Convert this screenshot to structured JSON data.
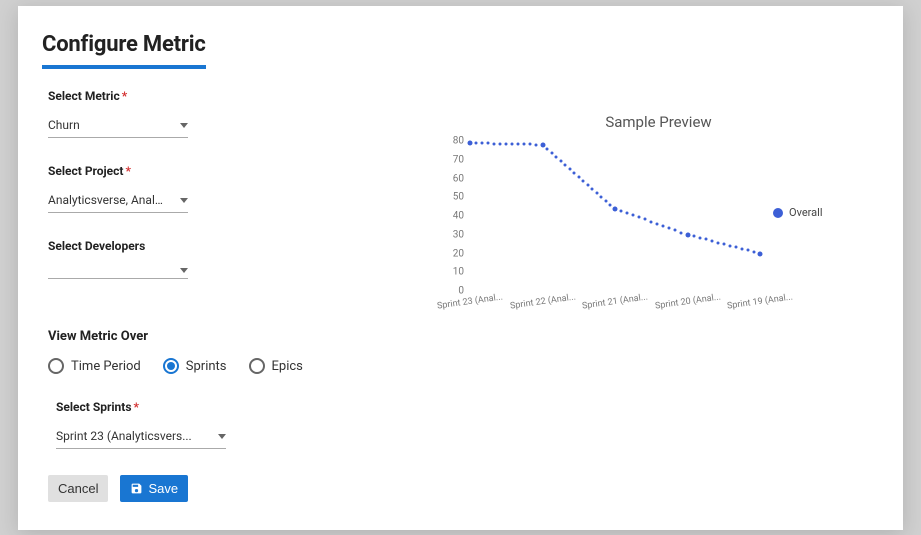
{
  "header": {
    "title": "Configure Metric"
  },
  "form": {
    "metric": {
      "label": "Select Metric",
      "required": true,
      "value": "Churn"
    },
    "project": {
      "label": "Select Project",
      "required": true,
      "value": "Analyticsverse, Analytic..."
    },
    "developers": {
      "label": "Select Developers",
      "required": false,
      "value": ""
    },
    "viewOver": {
      "heading": "View Metric Over",
      "options": {
        "time": "Time Period",
        "sprints": "Sprints",
        "epics": "Epics"
      },
      "selected": "sprints"
    },
    "sprints": {
      "label": "Select Sprints",
      "required": true,
      "value": "Sprint 23 (Analyticsvers..."
    }
  },
  "footer": {
    "cancel": "Cancel",
    "save": "Save"
  },
  "preview": {
    "title": "Sample Preview",
    "legend": {
      "label": "Overall",
      "color": "#3c5fd6"
    }
  },
  "chart_data": {
    "type": "line",
    "title": "Sample Preview",
    "xlabel": "",
    "ylabel": "",
    "ylim": [
      0,
      80
    ],
    "categories": [
      "Sprint 23 (Anal...",
      "Sprint 22 (Anal...",
      "Sprint 21 (Anal...",
      "Sprint 20 (Anal...",
      "Sprint 19 (Anal..."
    ],
    "series": [
      {
        "name": "Overall",
        "color": "#3c5fd6",
        "values": [
          79,
          78,
          44,
          30,
          20
        ]
      }
    ],
    "yticks": [
      0,
      10,
      20,
      30,
      40,
      50,
      60,
      70,
      80
    ]
  }
}
